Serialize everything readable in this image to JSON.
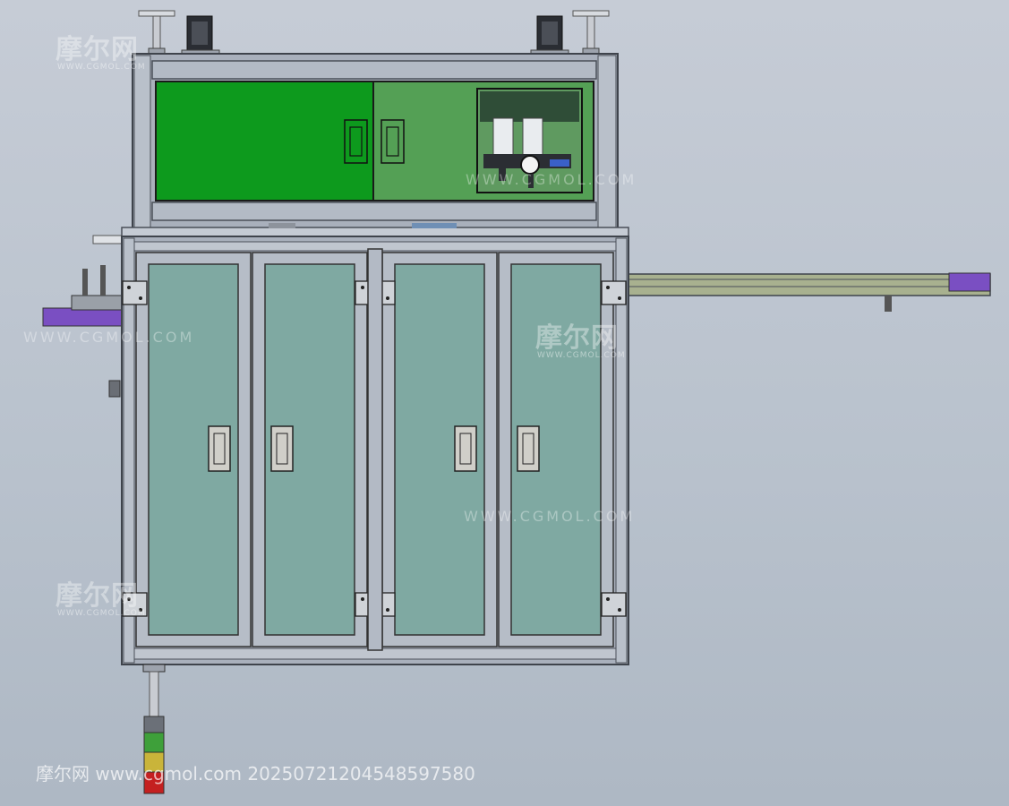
{
  "watermarks": {
    "logo_text": "摩尔网",
    "logo_sub": "WWW.CGMOL.COM",
    "url_text": "WWW.CGMOL.COM",
    "footer": "摩尔网 www.cgmol.com 20250721204548597580"
  },
  "colors": {
    "background": "#bcc4ce",
    "frame": "#a9b0bc",
    "frame_dark": "#4a4f58",
    "door_glass": "#7fa9a2",
    "panel_green_dark": "#0d9a1d",
    "panel_green_light": "#54a055",
    "accent_purple": "#7a4fc2",
    "light_green": "#3ea03a",
    "light_yellow": "#c9b43a",
    "light_red": "#c42020"
  }
}
